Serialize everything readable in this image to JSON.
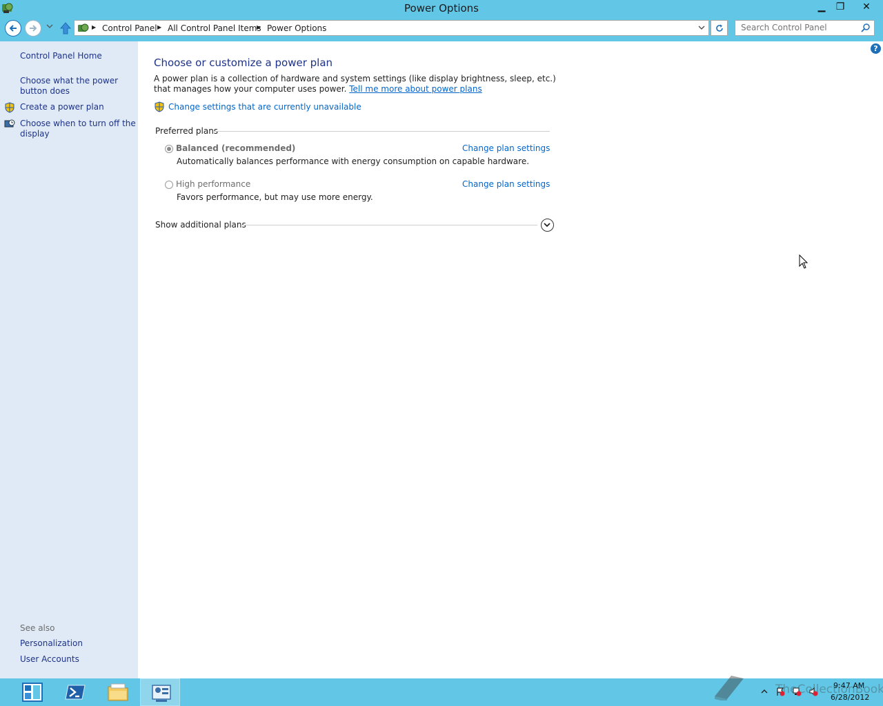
{
  "window": {
    "title": "Power Options",
    "min_label": "▁",
    "max_label": "❐",
    "close_label": "✕"
  },
  "address": {
    "crumbs": [
      "Control Panel",
      "All Control Panel Items",
      "Power Options"
    ],
    "search_placeholder": "Search Control Panel"
  },
  "sidebar": {
    "home": "Control Panel Home",
    "links": [
      "Choose what the power button does",
      "Create a power plan",
      "Choose when to turn off the display"
    ],
    "see_also_label": "See also",
    "see_also": [
      "Personalization",
      "User Accounts"
    ]
  },
  "main": {
    "title": "Choose or customize a power plan",
    "description": "A power plan is a collection of hardware and system settings (like display brightness, sleep, etc.) that manages how your computer uses power.",
    "learn_more_link": "Tell me more about power plans",
    "unavailable_link": "Change settings that are currently unavailable",
    "preferred_label": "Preferred plans",
    "plans": [
      {
        "name": "Balanced (recommended)",
        "description": "Automatically balances performance with energy consumption on capable hardware.",
        "selected": true,
        "settings_link": "Change plan settings"
      },
      {
        "name": "High performance",
        "description": "Favors performance, but may use more energy.",
        "selected": false,
        "settings_link": "Change plan settings"
      }
    ],
    "additional_label": "Show additional plans",
    "help_label": "?"
  },
  "taskbar": {
    "watermark": "TheCollectionBook",
    "time": "9:47 AM",
    "date": "6/28/2012"
  },
  "icons": [
    "app-control-panel-icon",
    "back-arrow-icon",
    "forward-arrow-icon",
    "up-arrow-icon",
    "refresh-icon",
    "search-icon",
    "shield-icon",
    "monitor-clock-icon",
    "help-icon",
    "chevron-down-icon"
  ],
  "colors": {
    "chrome": "#62c7e6",
    "sidebar": "#dfeaf6",
    "link": "#0066cc",
    "heading": "#1e3287"
  }
}
